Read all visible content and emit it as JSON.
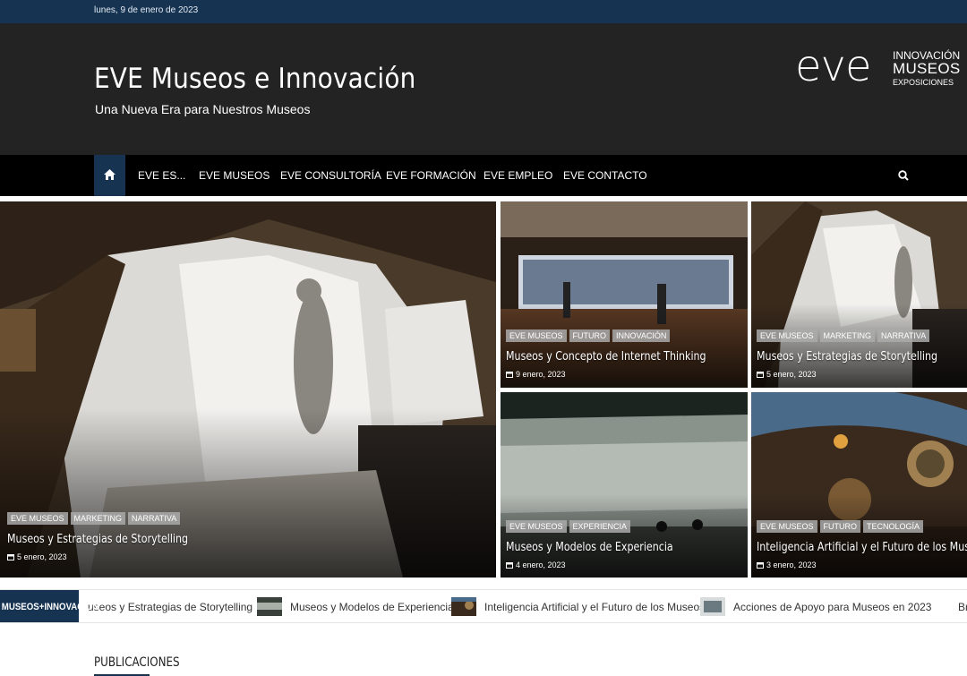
{
  "topbar": {
    "date": "lunes, 9 de enero de 2023"
  },
  "header": {
    "title": "EVE Museos e Innovación",
    "tagline": "Una Nueva Era para Nuestros Museos",
    "logo": {
      "mark": "eve",
      "line1": "INNOVACIÓN",
      "line2": "MUSEOS",
      "line3": "EXPOSICIONES"
    }
  },
  "nav": {
    "home_icon": "home-icon",
    "items": [
      "EVE ES...",
      "EVE MUSEOS",
      "EVE CONSULTORÍA",
      "EVE FORMACIÓN",
      "EVE EMPLEO",
      "EVE CONTACTO"
    ],
    "search_icon": "search-icon"
  },
  "featured": [
    {
      "categories": [
        "EVE MUSEOS",
        "MARKETING",
        "NARRATIVA"
      ],
      "title": "Museos y Estrategias de Storytelling",
      "date": "5 enero, 2023"
    },
    {
      "categories": [
        "EVE MUSEOS",
        "FUTURO",
        "INNOVACIÓN"
      ],
      "title": "Museos y Concepto de Internet Thinking",
      "date": "9 enero, 2023"
    },
    {
      "categories": [
        "EVE MUSEOS",
        "MARKETING",
        "NARRATIVA"
      ],
      "title": "Museos y Estrategias de Storytelling",
      "date": "5 enero, 2023"
    },
    {
      "categories": [
        "EVE MUSEOS",
        "EXPERIENCIA"
      ],
      "title": "Museos y Modelos de Experiencia",
      "date": "4 enero, 2023"
    },
    {
      "categories": [
        "EVE MUSEOS",
        "FUTURO",
        "TECNOLOGÍA"
      ],
      "title": "Inteligencia Artificial y el Futuro de los Museos",
      "date": "3 enero, 2023"
    }
  ],
  "ticker": {
    "label": "MUSEOS+INNOVACIÓN",
    "items": [
      "useos y Estrategias de Storytelling",
      "Museos y Modelos de Experiencia",
      "Inteligencia Artificial y el Futuro de los Museos",
      "Acciones de Apoyo para Museos en 2023",
      "Br"
    ]
  },
  "section": {
    "heading": "PUBLICACIONES"
  },
  "colors": {
    "accent": "#163452",
    "header_bg": "#232323",
    "nav_bg": "#000000"
  }
}
